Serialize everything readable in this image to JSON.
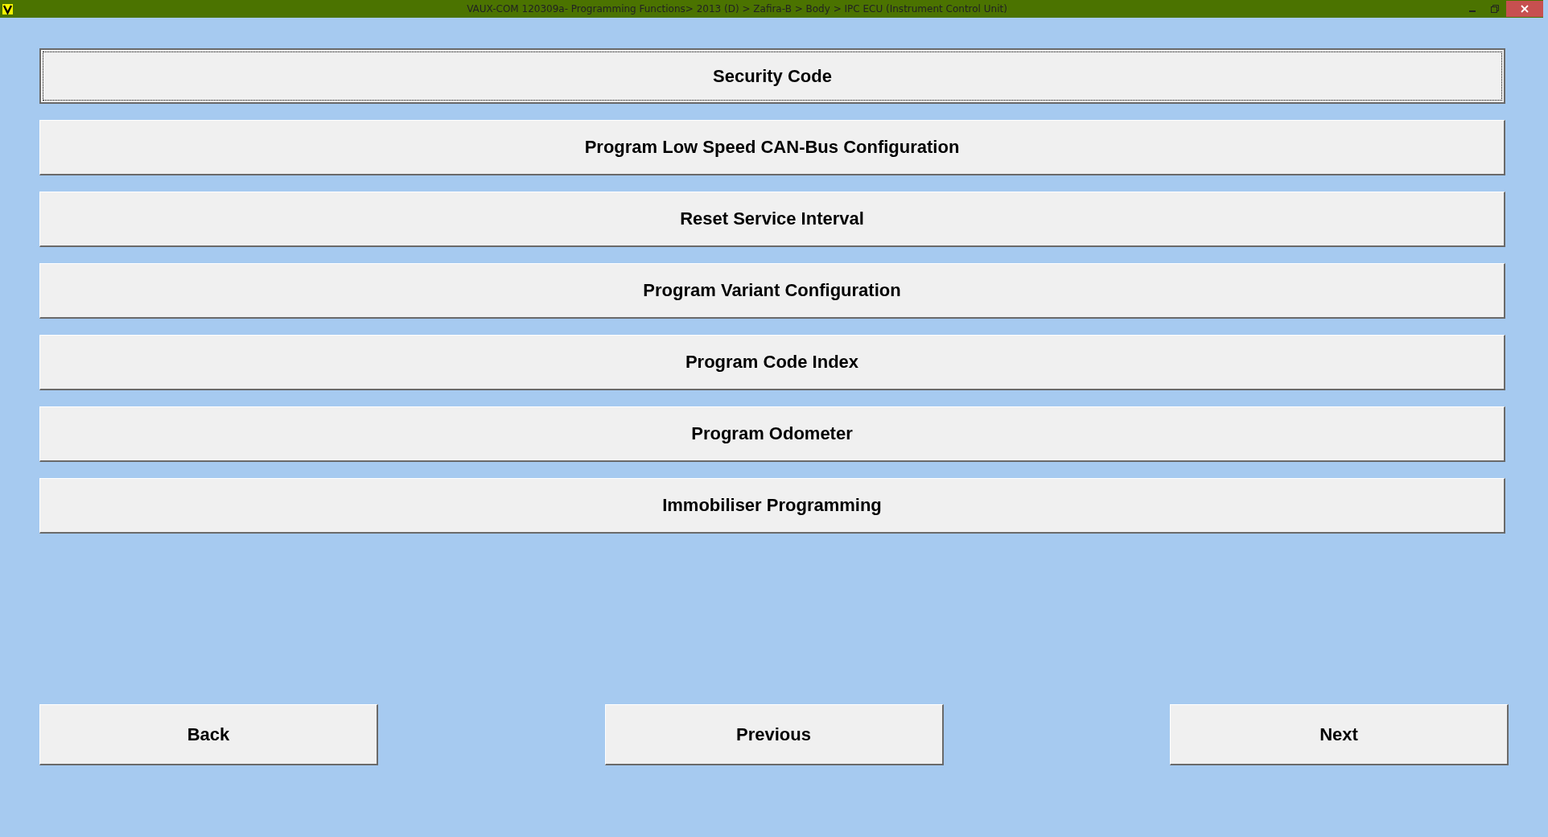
{
  "window": {
    "title": "VAUX-COM 120309a- Programming Functions> 2013 (D) > Zafira-B > Body > IPC ECU (Instrument Control Unit)"
  },
  "functions": [
    {
      "label": "Security Code",
      "focused": true
    },
    {
      "label": "Program Low Speed CAN-Bus Configuration",
      "focused": false
    },
    {
      "label": "Reset Service Interval",
      "focused": false
    },
    {
      "label": "Program Variant Configuration",
      "focused": false
    },
    {
      "label": "Program Code Index",
      "focused": false
    },
    {
      "label": "Program Odometer",
      "focused": false
    },
    {
      "label": "Immobiliser Programming",
      "focused": false
    }
  ],
  "navigation": [
    "Back",
    "Previous",
    "Next"
  ]
}
